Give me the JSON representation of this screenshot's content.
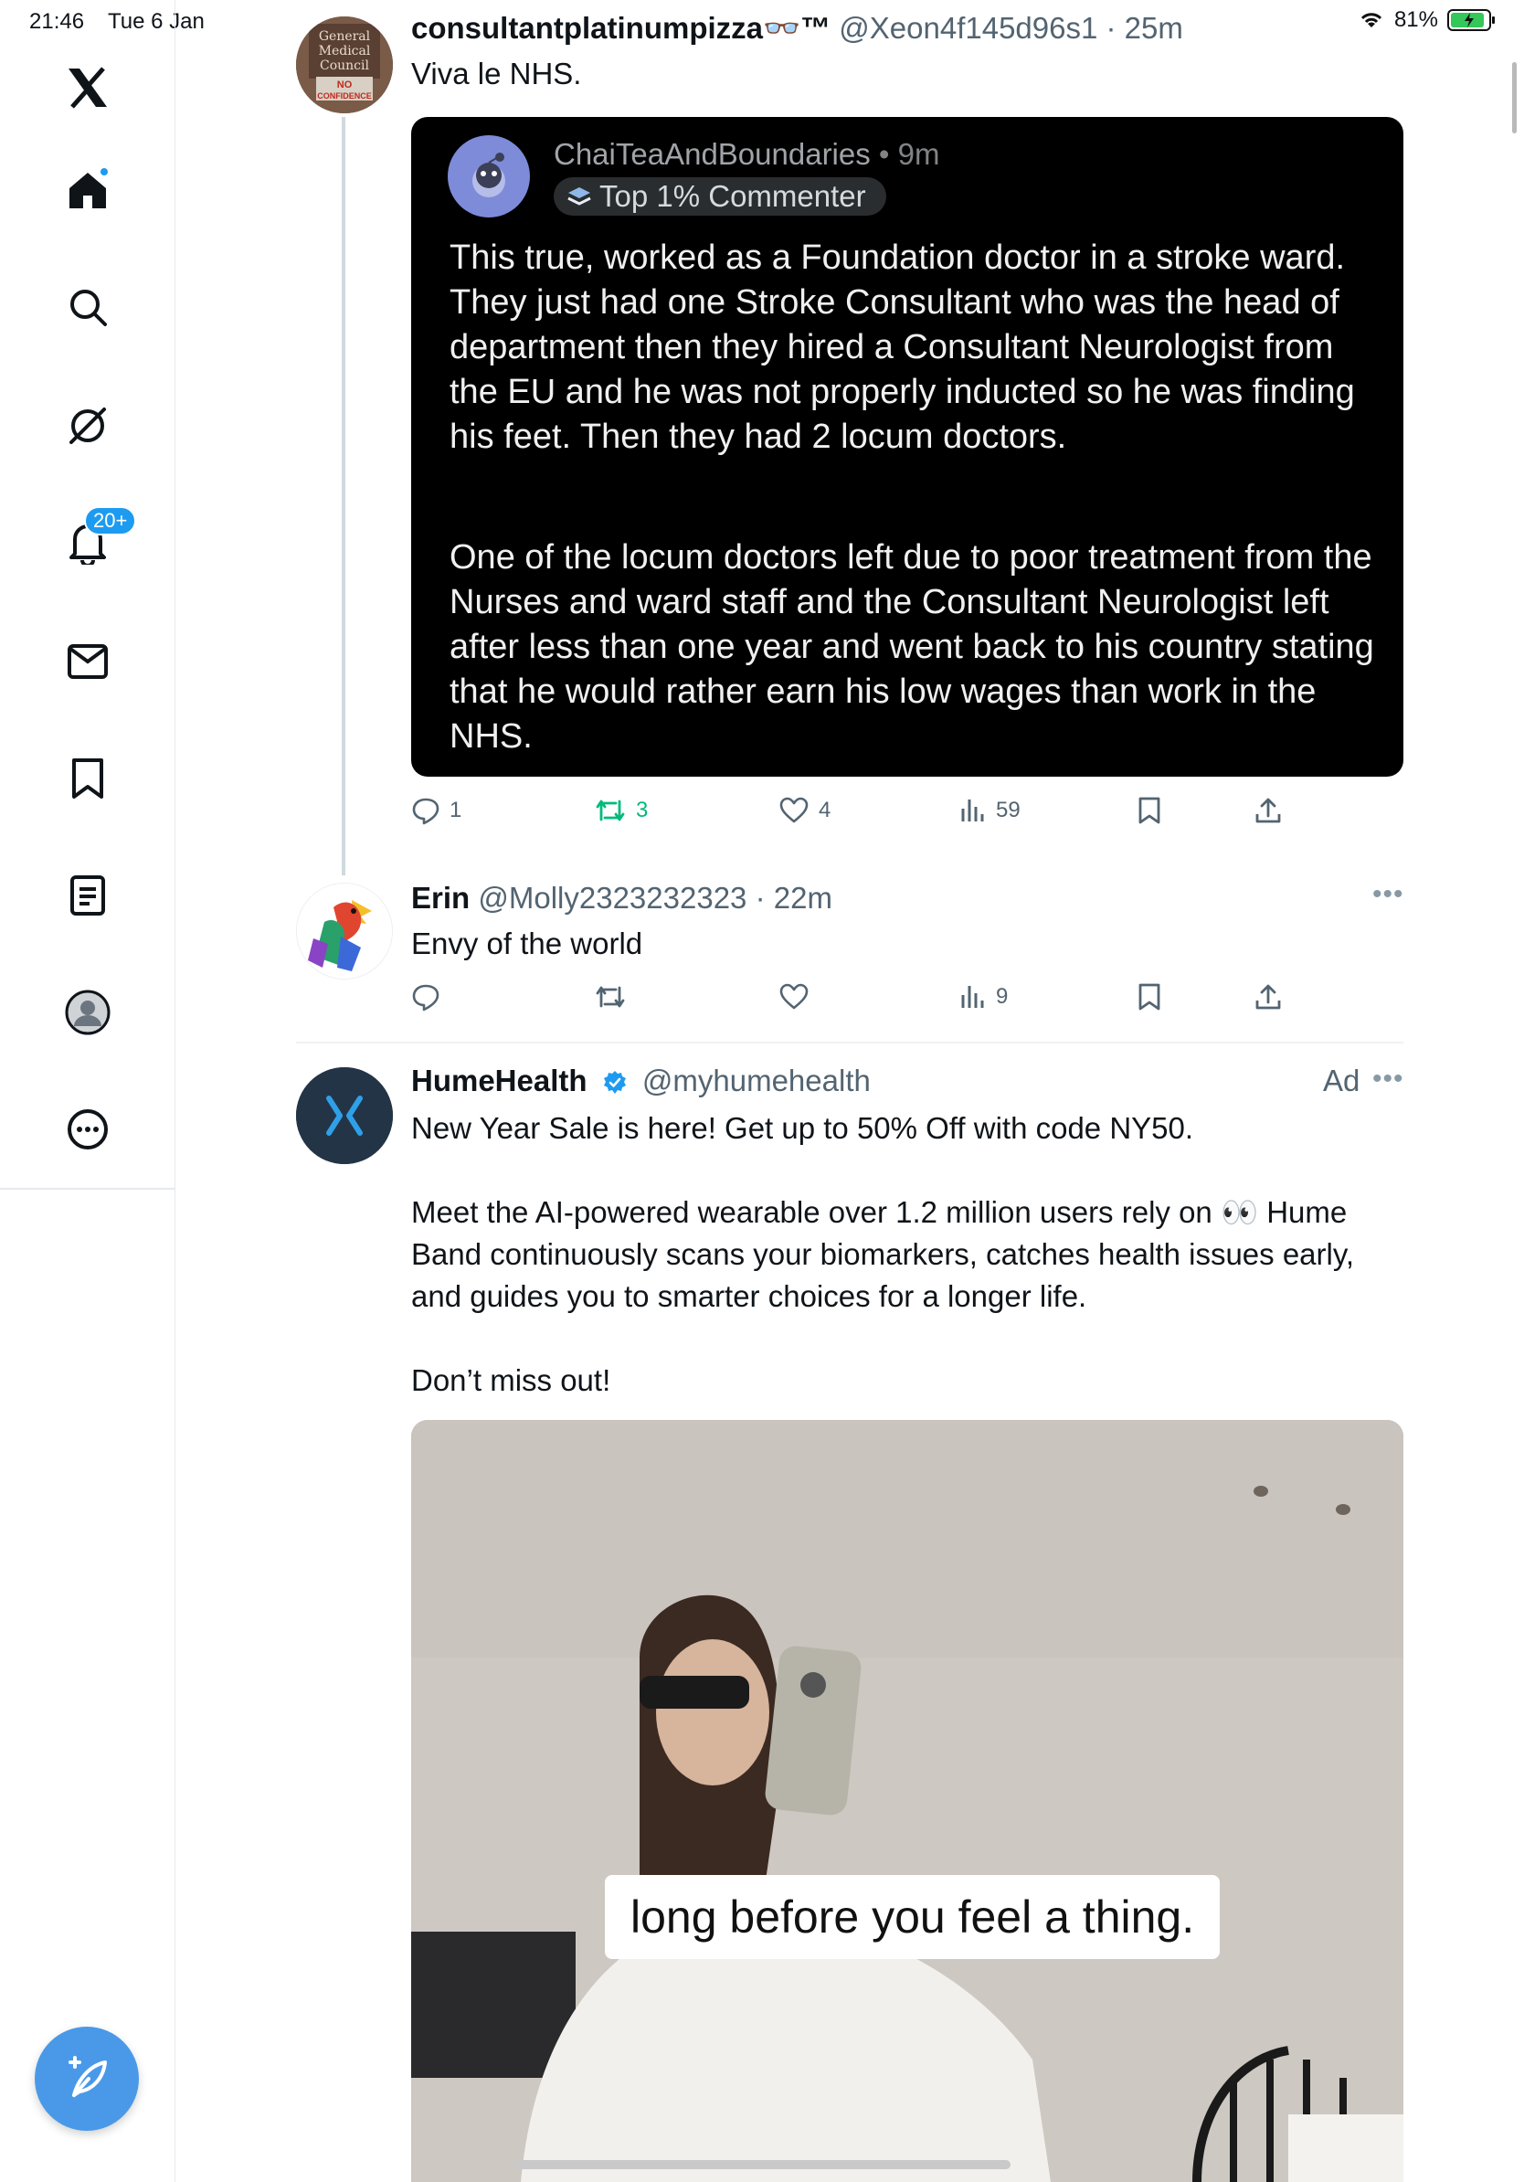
{
  "status_bar": {
    "time": "21:46",
    "date": "Tue 6 Jan",
    "battery": "81%"
  },
  "sidebar": {
    "items": [
      {
        "name": "logo",
        "icon": "x-logo-icon"
      },
      {
        "name": "home",
        "icon": "home-icon"
      },
      {
        "name": "explore",
        "icon": "search-icon"
      },
      {
        "name": "grok",
        "icon": "grok-icon"
      },
      {
        "name": "notifications",
        "icon": "bell-icon",
        "badge": "20+"
      },
      {
        "name": "messages",
        "icon": "mail-icon"
      },
      {
        "name": "bookmarks",
        "icon": "bookmark-icon"
      },
      {
        "name": "lists",
        "icon": "list-icon"
      },
      {
        "name": "profile",
        "icon": "profile-icon"
      },
      {
        "name": "more",
        "icon": "more-circle-icon"
      }
    ],
    "compose_icon": "compose-icon"
  },
  "posts": [
    {
      "name": "consultantplatinumpizza👓™",
      "handle": "@Xeon4f145d96s1",
      "time": "25m",
      "text": "Viva le NHS.",
      "avatar_text": [
        "General",
        "Medical",
        "Council",
        "NO",
        "CONFIDENCE"
      ],
      "quote": {
        "user": "ChaiTeaAndBoundaries",
        "time": "9m",
        "flair": "Top 1% Commenter",
        "paragraphs": [
          "This true, worked as a Foundation doctor in a stroke ward. They just had one Stroke Consultant who was the head of department then they hired a Consultant Neurologist from the EU and he was not properly inducted so he was finding his feet. Then they had 2 locum doctors.",
          "One of the locum doctors left due to poor treatment from the Nurses and ward staff and the Consultant Neurologist left after less than one year and went back to his country stating that he would rather earn his low wages than work in the NHS."
        ]
      },
      "stats": {
        "replies": "1",
        "reposts": "3",
        "likes": "4",
        "views": "59"
      }
    },
    {
      "name": "Erin",
      "handle": "@Molly2323232323",
      "time": "22m",
      "text": "Envy of the world",
      "stats": {
        "replies": "",
        "reposts": "",
        "likes": "",
        "views": "9"
      }
    },
    {
      "name": "HumeHealth",
      "handle": "@myhumehealth",
      "ad_label": "Ad",
      "text_lines": [
        "New Year Sale is here! Get up to 50% Off with code NY50.",
        "Meet the AI-powered wearable over 1.2 million users rely on 👀 Hume Band continuously scans your biomarkers, catches health issues early, and guides you to smarter choices for a longer life.",
        "Don’t miss out!"
      ],
      "media_caption": "long before you feel a thing."
    }
  ],
  "colors": {
    "accent": "#1d9bf0",
    "repost_green": "#00ba7c",
    "fab": "#4a99e9",
    "muted": "#536471"
  }
}
